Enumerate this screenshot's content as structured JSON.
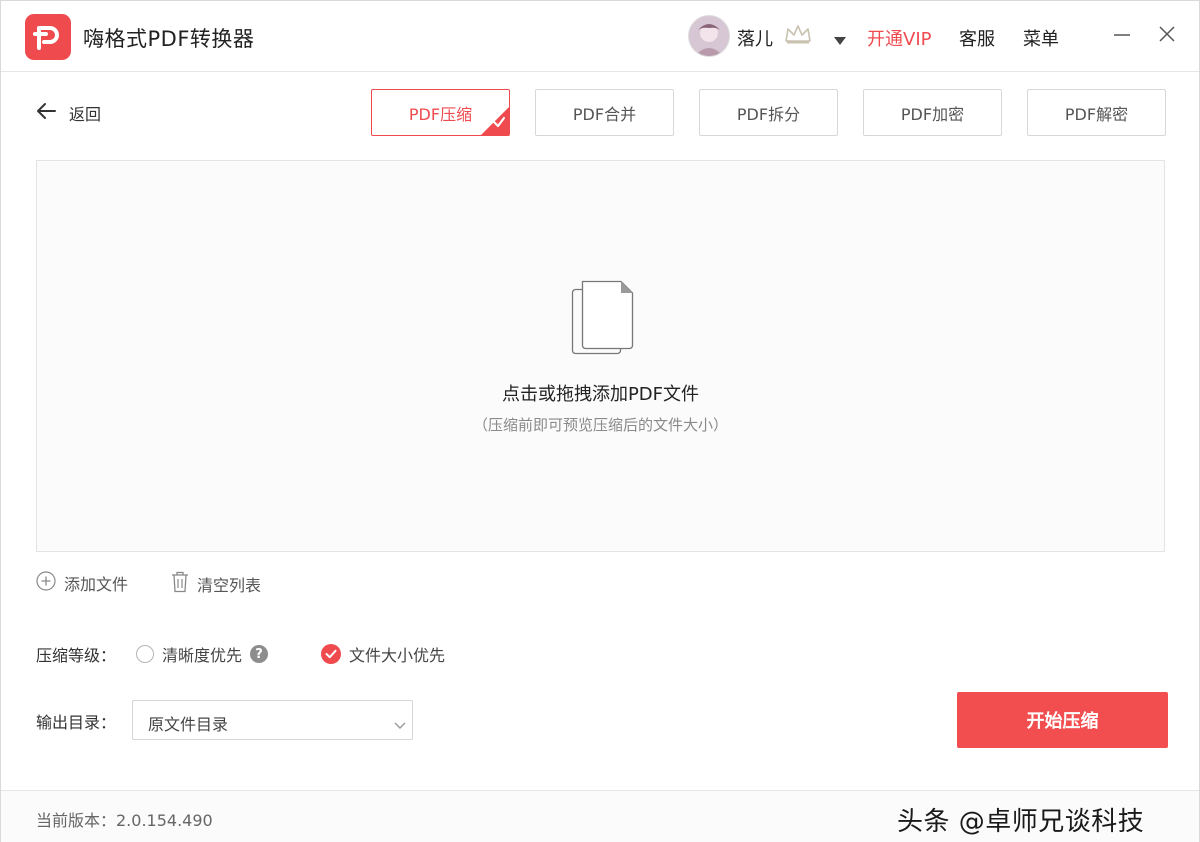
{
  "app": {
    "title": "嗨格式PDF转换器",
    "user_name": "落儿",
    "vip_label": "开通VIP",
    "service_label": "客服",
    "menu_label": "菜单"
  },
  "toolbar": {
    "back_label": "返回",
    "tabs": [
      {
        "label": "PDF压缩",
        "active": true
      },
      {
        "label": "PDF合并",
        "active": false
      },
      {
        "label": "PDF拆分",
        "active": false
      },
      {
        "label": "PDF加密",
        "active": false
      },
      {
        "label": "PDF解密",
        "active": false
      }
    ]
  },
  "dropzone": {
    "main_text": "点击或拖拽添加PDF文件",
    "sub_text": "（压缩前即可预览压缩后的文件大小）"
  },
  "list_actions": {
    "add_file": "添加文件",
    "clear_list": "清空列表"
  },
  "compression": {
    "label": "压缩等级：",
    "options": [
      {
        "label": "清晰度优先",
        "selected": false
      },
      {
        "label": "文件大小优先",
        "selected": true
      }
    ]
  },
  "output": {
    "label": "输出目录：",
    "selected": "原文件目录"
  },
  "start_button": "开始压缩",
  "footer": {
    "version": "当前版本：2.0.154.490",
    "watermark": "头条 @卓师兄谈科技"
  },
  "colors": {
    "accent": "#ef4b4f",
    "border": "#d8d8d8"
  },
  "icons": [
    "app-logo-icon",
    "crown-icon",
    "caret-down-icon",
    "minimize-icon",
    "close-icon",
    "back-arrow-icon",
    "check-icon",
    "document-icon",
    "add-circle-icon",
    "trash-icon",
    "help-icon",
    "chevron-down-icon"
  ]
}
